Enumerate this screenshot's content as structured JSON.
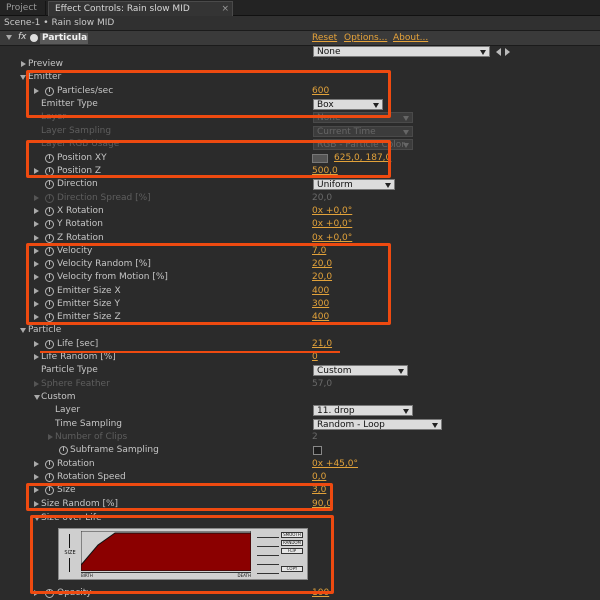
{
  "tabs": {
    "project": "Project",
    "effect_controls": "Effect Controls: Rain slow MID",
    "close": "×"
  },
  "scene": "Scene-1 • Rain slow MID",
  "effect": {
    "fx_label": "fx",
    "name": "Particular",
    "reset": "Reset",
    "options": "Options...",
    "about": "About...",
    "preset": "None"
  },
  "rows": {
    "preview": "Preview",
    "emitter": "Emitter",
    "particles_sec": {
      "label": "Particles/sec",
      "value": "600"
    },
    "emitter_type": {
      "label": "Emitter Type",
      "value": "Box"
    },
    "layer": {
      "label": "Layer",
      "value": "None"
    },
    "layer_sampling": {
      "label": "Layer Sampling",
      "value": "Current Time"
    },
    "layer_rgb_usage": {
      "label": "Layer RGB Usage",
      "value": "RGB - Particle Color"
    },
    "position_xy": {
      "label": "Position XY",
      "value": "625,0, 187,0"
    },
    "position_z": {
      "label": "Position Z",
      "value": "500,0"
    },
    "direction": {
      "label": "Direction",
      "value": "Uniform"
    },
    "direction_spread": {
      "label": "Direction Spread [%]",
      "value": "20,0"
    },
    "x_rotation": {
      "label": "X Rotation",
      "value": "0x +0,0°"
    },
    "y_rotation": {
      "label": "Y Rotation",
      "value": "0x +0,0°"
    },
    "z_rotation": {
      "label": "Z Rotation",
      "value": "0x +0,0°"
    },
    "velocity": {
      "label": "Velocity",
      "value": "7,0"
    },
    "velocity_random": {
      "label": "Velocity Random [%]",
      "value": "20,0"
    },
    "velocity_from_motion": {
      "label": "Velocity from Motion [%]",
      "value": "20,0"
    },
    "emitter_size_x": {
      "label": "Emitter Size X",
      "value": "400"
    },
    "emitter_size_y": {
      "label": "Emitter Size Y",
      "value": "300"
    },
    "emitter_size_z": {
      "label": "Emitter Size Z",
      "value": "400"
    },
    "particle": "Particle",
    "life": {
      "label": "Life [sec]",
      "value": "21,0"
    },
    "life_random": {
      "label": "Life Random [%]",
      "value": "0"
    },
    "particle_type": {
      "label": "Particle Type",
      "value": "Custom"
    },
    "sphere_feather": {
      "label": "Sphere Feather",
      "value": "57,0"
    },
    "custom": "Custom",
    "custom_layer": {
      "label": "Layer",
      "value": "11. drop"
    },
    "time_sampling": {
      "label": "Time Sampling",
      "value": "Random - Loop"
    },
    "number_of_clips": {
      "label": "Number of Clips",
      "value": "2"
    },
    "subframe_sampling": {
      "label": "Subframe Sampling"
    },
    "rotation": {
      "label": "Rotation",
      "value": "0x +45,0°"
    },
    "rotation_speed": {
      "label": "Rotation Speed",
      "value": "0,0"
    },
    "size": {
      "label": "Size",
      "value": "3,0"
    },
    "size_random": {
      "label": "Size Random [%]",
      "value": "90,0"
    },
    "size_over_life": "Size over Life",
    "opacity": {
      "label": "Opacity",
      "value": "100"
    }
  },
  "graph": {
    "size_label": "SIZE",
    "birth": "BIRTH",
    "death": "DEATH",
    "buttons": [
      "SMOOTH",
      "RANDOM",
      "FLIP",
      "COPY"
    ],
    "curve_fraction": 0.2
  },
  "colors": {
    "accent_value": "#e2a23a",
    "highlight": "#ee4a10",
    "curve_fill": "#8b0000"
  }
}
